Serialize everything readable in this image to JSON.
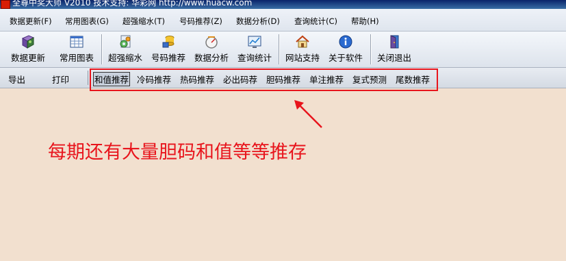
{
  "window": {
    "title": "全尊中奖大师  V2010  技术支持: 华彩网  http://www.huacw.com"
  },
  "menu": {
    "items": [
      {
        "id": "data-update",
        "label": "数据更新(F)"
      },
      {
        "id": "charts",
        "label": "常用图表(G)"
      },
      {
        "id": "super-shrink",
        "label": "超强缩水(T)"
      },
      {
        "id": "number-recommend",
        "label": "号码推荐(Z)"
      },
      {
        "id": "data-analysis",
        "label": "数据分析(D)"
      },
      {
        "id": "query-stats",
        "label": "查询统计(C)"
      },
      {
        "id": "help",
        "label": "帮助(H)"
      }
    ]
  },
  "toolbar": {
    "buttons": [
      {
        "id": "data-update",
        "label": "数据更新",
        "icon": "book-icon"
      },
      {
        "id": "charts",
        "label": "常用图表",
        "icon": "grid-chart-icon"
      },
      {
        "id": "super-shrink",
        "label": "超强缩水",
        "icon": "gear-icon"
      },
      {
        "id": "number-recommend",
        "label": "号码推荐",
        "icon": "coins-icon"
      },
      {
        "id": "data-analysis",
        "label": "数据分析",
        "icon": "gauge-icon"
      },
      {
        "id": "query-stats",
        "label": "查询统计",
        "icon": "screen-chart-icon"
      },
      {
        "id": "website",
        "label": "网站支持",
        "icon": "house-icon"
      },
      {
        "id": "about",
        "label": "关于软件",
        "icon": "info-icon"
      },
      {
        "id": "exit",
        "label": "关闭退出",
        "icon": "door-exit-icon"
      }
    ]
  },
  "funcbar": {
    "export_label": "导出",
    "print_label": "打印",
    "tabs": [
      {
        "id": "sum-value",
        "label": "和值推荐",
        "active": true
      },
      {
        "id": "cold",
        "label": "冷码推荐"
      },
      {
        "id": "hot",
        "label": "热码推荐"
      },
      {
        "id": "must",
        "label": "必出码荐"
      },
      {
        "id": "dan",
        "label": "胆码推荐"
      },
      {
        "id": "single",
        "label": "单注推荐"
      },
      {
        "id": "compound",
        "label": "复式预测"
      },
      {
        "id": "tail",
        "label": "尾数推荐"
      }
    ]
  },
  "annotation": {
    "text": "每期还有大量胆码和值等等推存",
    "color": "#e8141c"
  }
}
